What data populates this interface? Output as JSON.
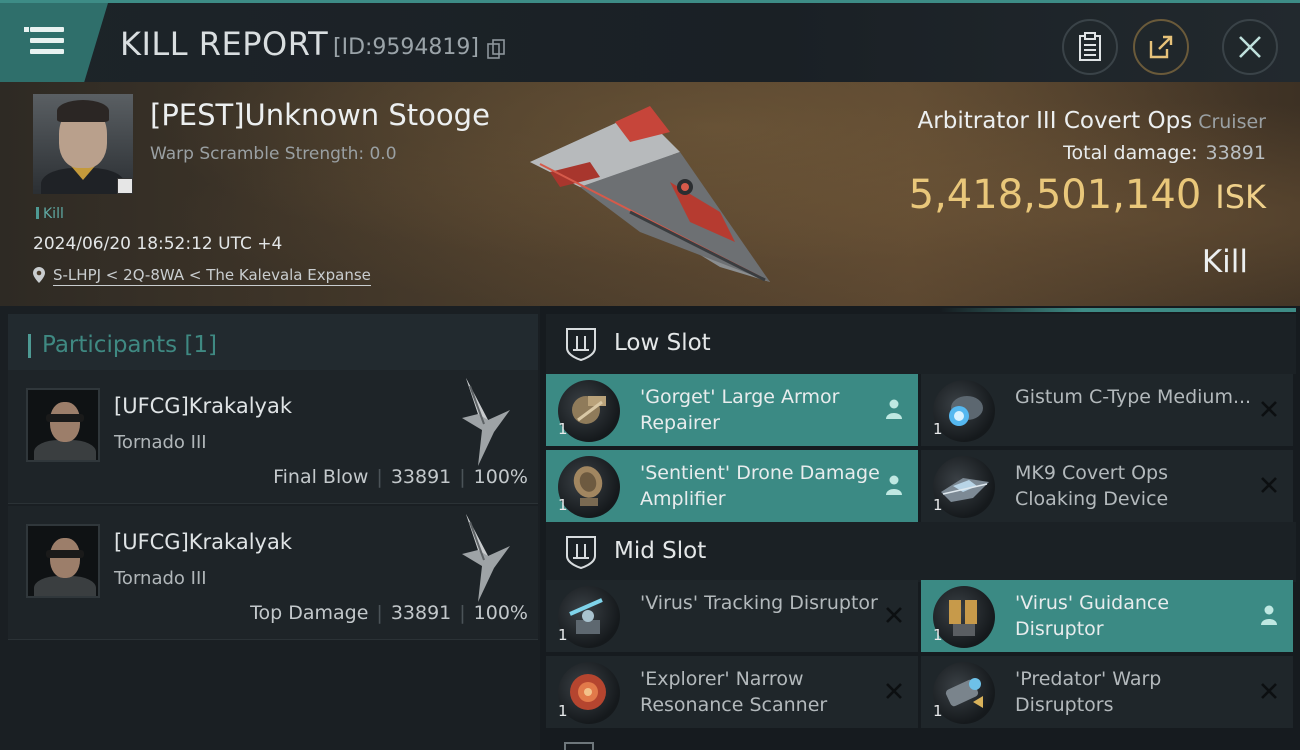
{
  "header": {
    "title": "KILL REPORT",
    "kill_id": "[ID:9594819]"
  },
  "victim": {
    "name": "[PEST]Unknown Stooge",
    "warp_scramble": "Warp Scramble Strength: 0.0",
    "tag": "Kill",
    "datetime": "2024/06/20 18:52:12 UTC +4",
    "location": "S-LHPJ < 2Q-8WA < The Kalevala Expanse",
    "ship_name": "Arbitrator III Covert Ops",
    "ship_class": "Cruiser",
    "total_damage_label": "Total damage:",
    "total_damage": "33891",
    "isk_value": "5,418,501,140",
    "isk_unit": "ISK",
    "result": "Kill"
  },
  "participants": {
    "label": "Participants [1]",
    "rows": [
      {
        "name": "[UFCG]Krakalyak",
        "ship": "Tornado III",
        "role": "Final Blow",
        "damage": "33891",
        "percent": "100%"
      },
      {
        "name": "[UFCG]Krakalyak",
        "ship": "Tornado III",
        "role": "Top Damage",
        "damage": "33891",
        "percent": "100%"
      }
    ]
  },
  "fitting": {
    "low_slot_label": "Low Slot",
    "mid_slot_label": "Mid Slot",
    "low_modules": [
      {
        "name": "'Gorget' Large Armor Repairer",
        "qty": "1",
        "state": "dropped",
        "icon": "armor-repairer-icon"
      },
      {
        "name": "Gistum C-Type Medium...",
        "qty": "1",
        "state": "destroyed",
        "icon": "shield-booster-icon"
      },
      {
        "name": "'Sentient' Drone Damage Amplifier",
        "qty": "1",
        "state": "dropped",
        "icon": "drone-amplifier-icon"
      },
      {
        "name": "MK9 Covert Ops Cloaking Device",
        "qty": "1",
        "state": "destroyed",
        "icon": "cloaking-device-icon"
      }
    ],
    "mid_modules": [
      {
        "name": "'Virus' Tracking Disruptor",
        "qty": "1",
        "state": "destroyed",
        "icon": "tracking-disruptor-icon"
      },
      {
        "name": "'Virus' Guidance Disruptor",
        "qty": "1",
        "state": "dropped",
        "icon": "guidance-disruptor-icon"
      },
      {
        "name": "'Explorer' Narrow Resonance Scanner",
        "qty": "1",
        "state": "destroyed",
        "icon": "scanner-icon"
      },
      {
        "name": "'Predator' Warp Disruptors",
        "qty": "1",
        "state": "destroyed",
        "icon": "warp-disruptor-icon"
      }
    ]
  },
  "colors": {
    "accent_teal": "#3b8a84",
    "isk_gold": "#e9c77a",
    "background": "#14191d"
  }
}
